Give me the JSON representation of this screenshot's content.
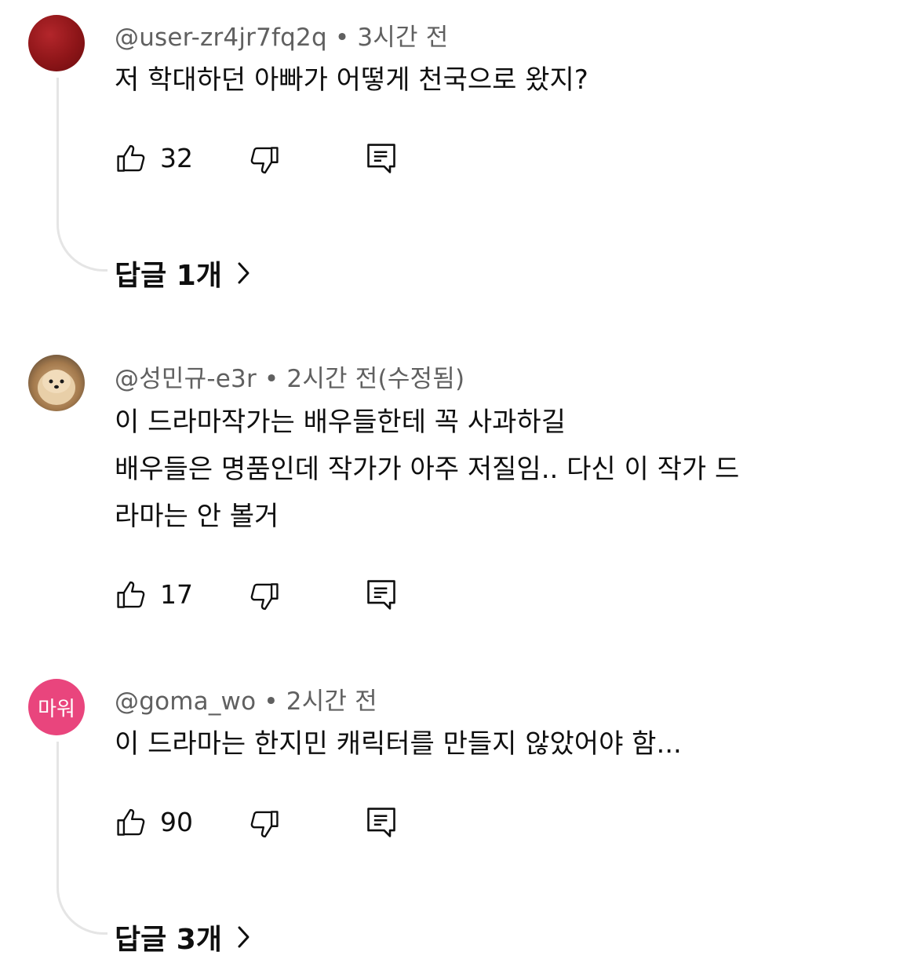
{
  "comments": [
    {
      "author": "@user-zr4jr7fq2q",
      "time": "3시간 전",
      "lines": [
        "저 학대하던 아빠가 어떻게 천국으로 왔지?"
      ],
      "likes": "32",
      "replies_label": "답글 1개",
      "avatar_color": "#8d1518"
    },
    {
      "author": "@성민규-e3r",
      "time": "2시간 전(수정됨)",
      "lines": [
        "이 드라마작가는 배우들한테 꼭 사과하길",
        "배우들은 명품인데 작가가 아주 저질임.. 다신 이 작가 드",
        "라마는 안 볼거"
      ],
      "likes": "17"
    },
    {
      "author": "@goma_wo",
      "time": "2시간 전",
      "lines": [
        "이 드라마는 한지민 캐릭터를 만들지 않았어야 함..."
      ],
      "likes": "90",
      "replies_label": "답글 3개",
      "avatar_text": "마워",
      "avatar_color": "#e9457d"
    }
  ],
  "separator": "•",
  "icons": {
    "like": "thumbs-up-icon",
    "dislike": "thumbs-down-icon",
    "reply": "comment-icon",
    "chevron": "chevron-right-icon"
  }
}
